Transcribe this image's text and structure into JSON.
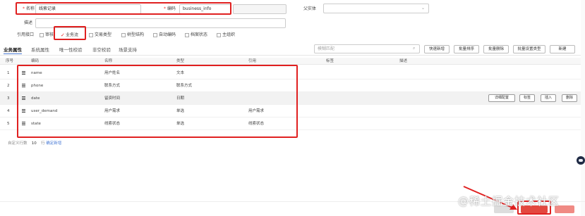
{
  "form": {
    "name_label": "名称",
    "name_value": "线索记录",
    "code_label": "编码",
    "code_value": "business_info",
    "parent_label": "父实体",
    "desc_label": "描述",
    "ref_label": "引用接口",
    "required_mark": "*"
  },
  "checks": [
    {
      "label": "审核",
      "checked": false
    },
    {
      "label": "业务流",
      "checked": true
    },
    {
      "label": "交易类型",
      "checked": false
    },
    {
      "label": "树型结构",
      "checked": false
    },
    {
      "label": "自动编码",
      "checked": false
    },
    {
      "label": "档案状态",
      "checked": false
    },
    {
      "label": "主组织",
      "checked": false
    }
  ],
  "tabs": [
    "业务属性",
    "系统属性",
    "唯一性校验",
    "非空校验",
    "场景支持"
  ],
  "toolbar": {
    "search_placeholder": "模糊匹配",
    "buttons": [
      "快速新增",
      "批量排序",
      "批量删除",
      "批量设置类型",
      "新建"
    ]
  },
  "table": {
    "headers": [
      "序号",
      "编码",
      "名称",
      "类型",
      "引用",
      "标签",
      "描述"
    ],
    "rows": [
      {
        "idx": "1",
        "code": "name",
        "name": "用户姓名",
        "type": "文本",
        "ref": ""
      },
      {
        "idx": "2",
        "code": "phone",
        "name": "联系方式",
        "type": "联系方式",
        "ref": ""
      },
      {
        "idx": "3",
        "code": "date",
        "name": "留资时间",
        "type": "日期",
        "ref": ""
      },
      {
        "idx": "4",
        "code": "user_demand",
        "name": "用户需求",
        "type": "单选",
        "ref": "用户需求"
      },
      {
        "idx": "5",
        "code": "state",
        "name": "线索状态",
        "type": "单选",
        "ref": "线索状态"
      }
    ],
    "row_actions": [
      "详细配置",
      "标签",
      "插入",
      "删除"
    ]
  },
  "footer": {
    "prefix": "自定义行数",
    "count": "10",
    "suffix": "行",
    "link": "确定新增"
  },
  "watermark": "@稀土掘金技术社区",
  "colors": {
    "annotation_red": "#e02020",
    "link_blue": "#4a7bd6",
    "primary_red": "#e3483f"
  }
}
